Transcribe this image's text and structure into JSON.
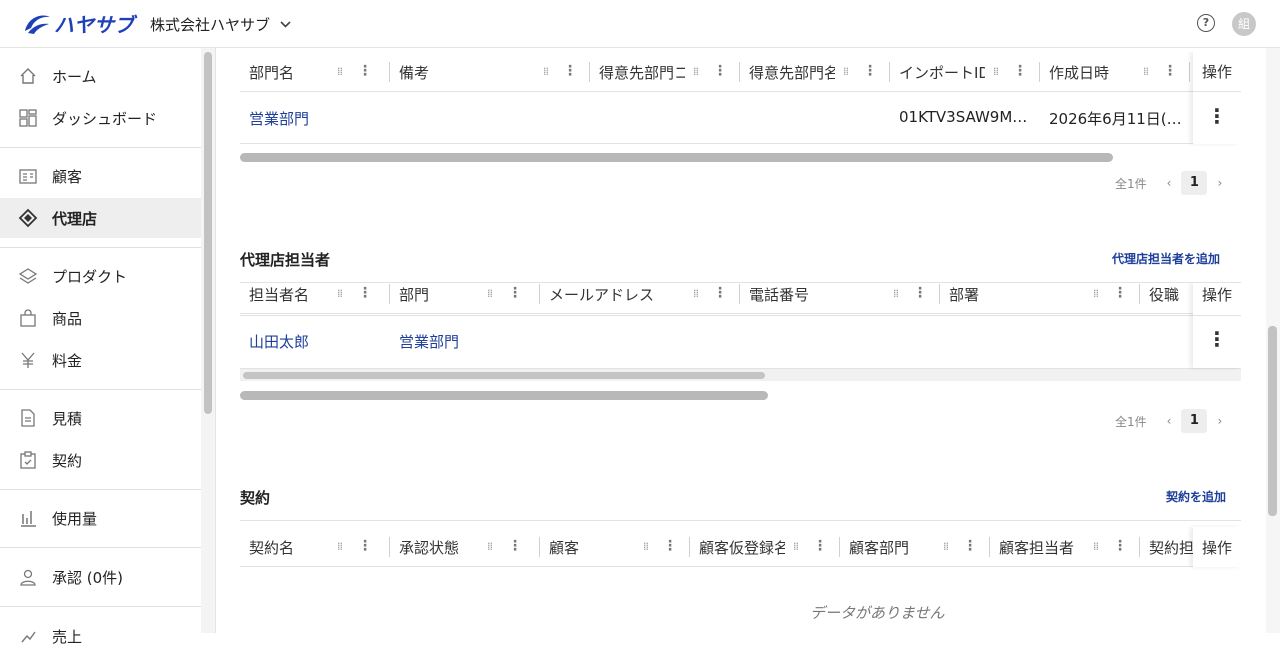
{
  "header": {
    "logo_text": "ハヤサブ",
    "company": "株式会社ハヤサブ",
    "help_glyph": "?",
    "avatar": "組"
  },
  "sidebar": {
    "items": [
      {
        "label": "ホーム",
        "icon": "home-icon"
      },
      {
        "label": "ダッシュボード",
        "icon": "dashboard-icon"
      },
      {
        "label": "顧客",
        "icon": "customer-icon"
      },
      {
        "label": "代理店",
        "icon": "agency-icon",
        "active": true
      },
      {
        "label": "プロダクト",
        "icon": "layers-icon"
      },
      {
        "label": "商品",
        "icon": "bag-icon"
      },
      {
        "label": "料金",
        "icon": "yen-icon"
      },
      {
        "label": "見積",
        "icon": "document-icon"
      },
      {
        "label": "契約",
        "icon": "clipboard-icon"
      },
      {
        "label": "使用量",
        "icon": "bar-chart-icon"
      },
      {
        "label": "承認 (0件)",
        "icon": "user-check-icon"
      },
      {
        "label": "売上",
        "icon": "sales-icon"
      }
    ]
  },
  "departments": {
    "columns": [
      "部門名",
      "備考",
      "得意先部門コード",
      "得意先部門名",
      "インポートID",
      "作成日時"
    ],
    "op_label": "操作",
    "rows": [
      {
        "name": "営業部門",
        "note": "",
        "code": "",
        "dept": "",
        "import_id": "01KTV3SAW9M…",
        "created": "2026年6月11日(…"
      }
    ],
    "pager": {
      "total": "全1件",
      "page": "1"
    }
  },
  "agency_staff": {
    "title": "代理店担当者",
    "add_label": "代理店担当者を追加",
    "columns": [
      "担当者名",
      "部門",
      "メールアドレス",
      "電話番号",
      "部署",
      "役職"
    ],
    "op_label": "操作",
    "rows": [
      {
        "name": "山田太郎",
        "dept": "営業部門"
      }
    ],
    "pager": {
      "total": "全1件",
      "page": "1"
    }
  },
  "contracts": {
    "title": "契約",
    "add_label": "契約を追加",
    "columns": [
      "契約名",
      "承認状態",
      "顧客",
      "顧客仮登録名",
      "顧客部門",
      "顧客担当者",
      "契約担当"
    ],
    "op_label": "操作",
    "empty": "データがありません"
  },
  "colors": {
    "accent": "#1e3f9a",
    "logo": "#1e40b8"
  }
}
